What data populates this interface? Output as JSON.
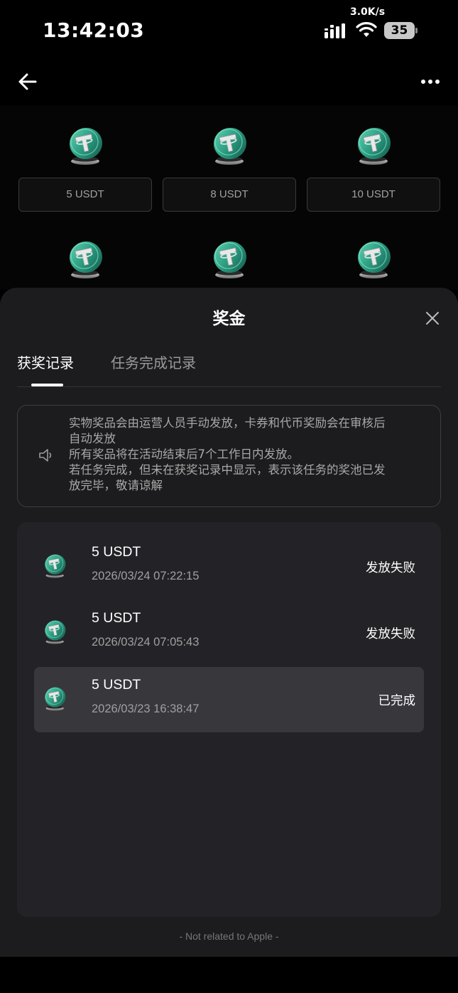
{
  "status_bar": {
    "time": "13:42:03",
    "net_speed": "3.0K/s",
    "battery": "35"
  },
  "rewards_grid": {
    "row1": [
      {
        "label": "5 USDT"
      },
      {
        "label": "8 USDT"
      },
      {
        "label": "10 USDT"
      }
    ]
  },
  "sheet": {
    "title": "奖金",
    "tabs": [
      {
        "label": "获奖记录",
        "active": true
      },
      {
        "label": "任务完成记录",
        "active": false
      }
    ],
    "notice": {
      "line1": "实物奖品会由运营人员手动发放，卡券和代币奖励会在审核后",
      "line2": "自动发放",
      "line3": "所有奖品将在活动结束后7个工作日内发放。",
      "line4": "若任务完成，但未在获奖记录中显示，表示该任务的奖池已发",
      "line5": "放完毕，敬请谅解"
    },
    "records": [
      {
        "amount": "5 USDT",
        "time": "2026/03/24 07:22:15",
        "status": "发放失败"
      },
      {
        "amount": "5 USDT",
        "time": "2026/03/24 07:05:43",
        "status": "发放失败"
      },
      {
        "amount": "5 USDT",
        "time": "2026/03/23 16:38:47",
        "status": "已完成"
      }
    ],
    "footer": "- Not related to Apple -"
  },
  "icons": {
    "coin": "usdt-coin-icon",
    "back": "back-arrow-icon",
    "more": "more-dots-icon",
    "close": "close-icon",
    "speaker": "speaker-icon"
  },
  "colors": {
    "coin_green": "#2fa88a",
    "sheet_bg": "#1c1c1e",
    "card_bg": "#232327",
    "highlight_row": "#37373c"
  }
}
